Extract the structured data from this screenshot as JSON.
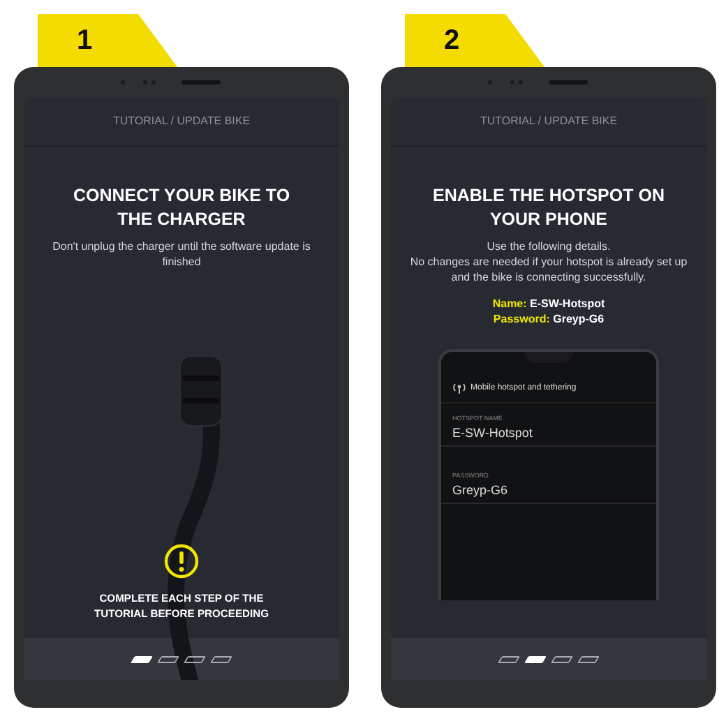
{
  "panels": [
    {
      "step": "1",
      "kind": "charger",
      "header": "TUTORIAL / UPDATE BIKE",
      "title": "CONNECT YOUR BIKE TO THE CHARGER",
      "lines": [
        "Don't unplug the charger until the software update is finished"
      ],
      "warning": "COMPLETE EACH STEP OF THE TUTORIAL BEFORE PROCEEDING",
      "pages": [
        {
          "selected": true
        },
        {
          "selected": false
        },
        {
          "selected": false
        },
        {
          "selected": false
        }
      ]
    },
    {
      "step": "2",
      "kind": "hotspot",
      "header": "TUTORIAL / UPDATE BIKE",
      "title": "ENABLE THE HOTSPOT ON YOUR PHONE",
      "lines": [
        "Use the following details.",
        "No changes are needed if your hotspot is already set up and the bike is connecting successfully."
      ],
      "details": [
        {
          "label": "Name:",
          "value": "E-SW-Hotspot"
        },
        {
          "label": "Password:",
          "value": "Greyp-G6"
        }
      ],
      "inner_phone": {
        "title": "Mobile hotspot and tethering",
        "fields": [
          {
            "label": "HOTSPOT NAME",
            "value": "E-SW-Hotspot"
          },
          {
            "label": "PASSWORD",
            "value": "Greyp-G6"
          }
        ]
      },
      "pages": [
        {
          "selected": false
        },
        {
          "selected": true
        },
        {
          "selected": false
        },
        {
          "selected": false
        }
      ]
    }
  ]
}
